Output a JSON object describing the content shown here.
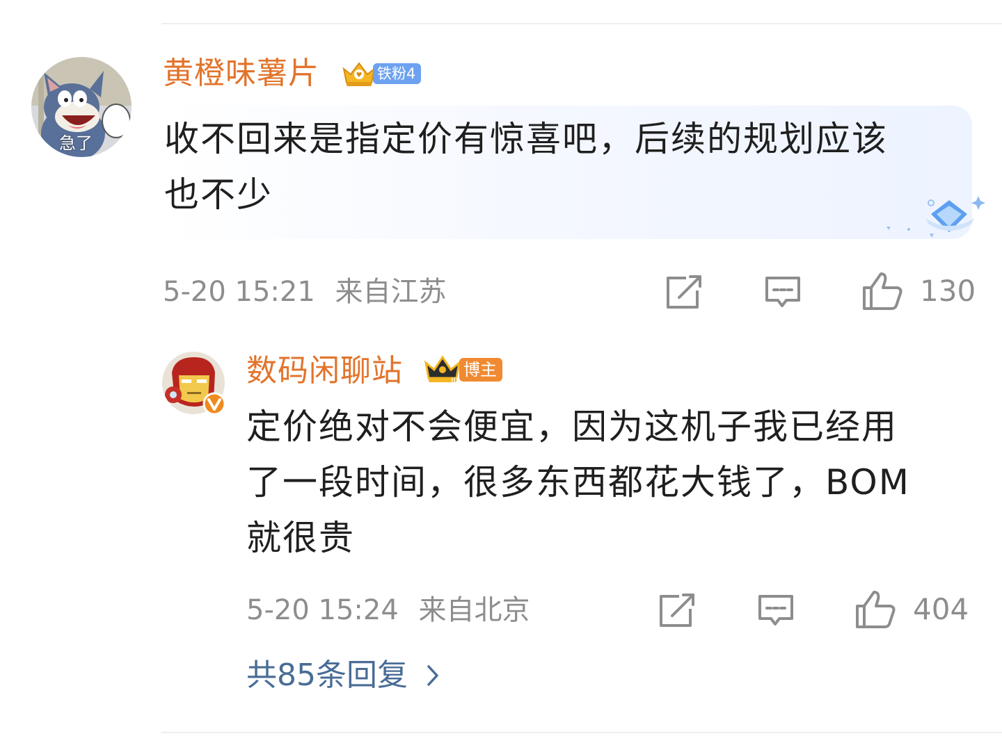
{
  "comment": {
    "username": "黄橙味薯片",
    "fan_badge": "铁粉4",
    "avatar_caption": "急了",
    "text_line1": "收不回来是指定价有惊喜吧，后续的规划应该",
    "text_line2": "也不少",
    "timestamp": "5-20 15:21",
    "location": "来自江苏",
    "like_count": "130",
    "colors": {
      "username": "#e2742c",
      "fan_badge_bg": "#6ea2f0"
    }
  },
  "reply": {
    "username": "数码闲聊站",
    "role_badge": "博主",
    "text_line1": "定价绝对不会便宜，因为这机子我已经用",
    "text_line2": "了一段时间，很多东西都花大钱了，BOM",
    "text_line3": "就很贵",
    "timestamp": "5-20 15:24",
    "location": "来自北京",
    "like_count": "404",
    "colors": {
      "username": "#e2742c",
      "role_badge_bg": "#f08a32"
    }
  },
  "more_replies": {
    "label": "共85条回复",
    "color": "#4a6c96"
  },
  "icons": [
    "crown-icon",
    "share-icon",
    "comment-icon",
    "like-icon",
    "chevron-right-icon",
    "verified-icon",
    "diamond-decoration-icon"
  ]
}
